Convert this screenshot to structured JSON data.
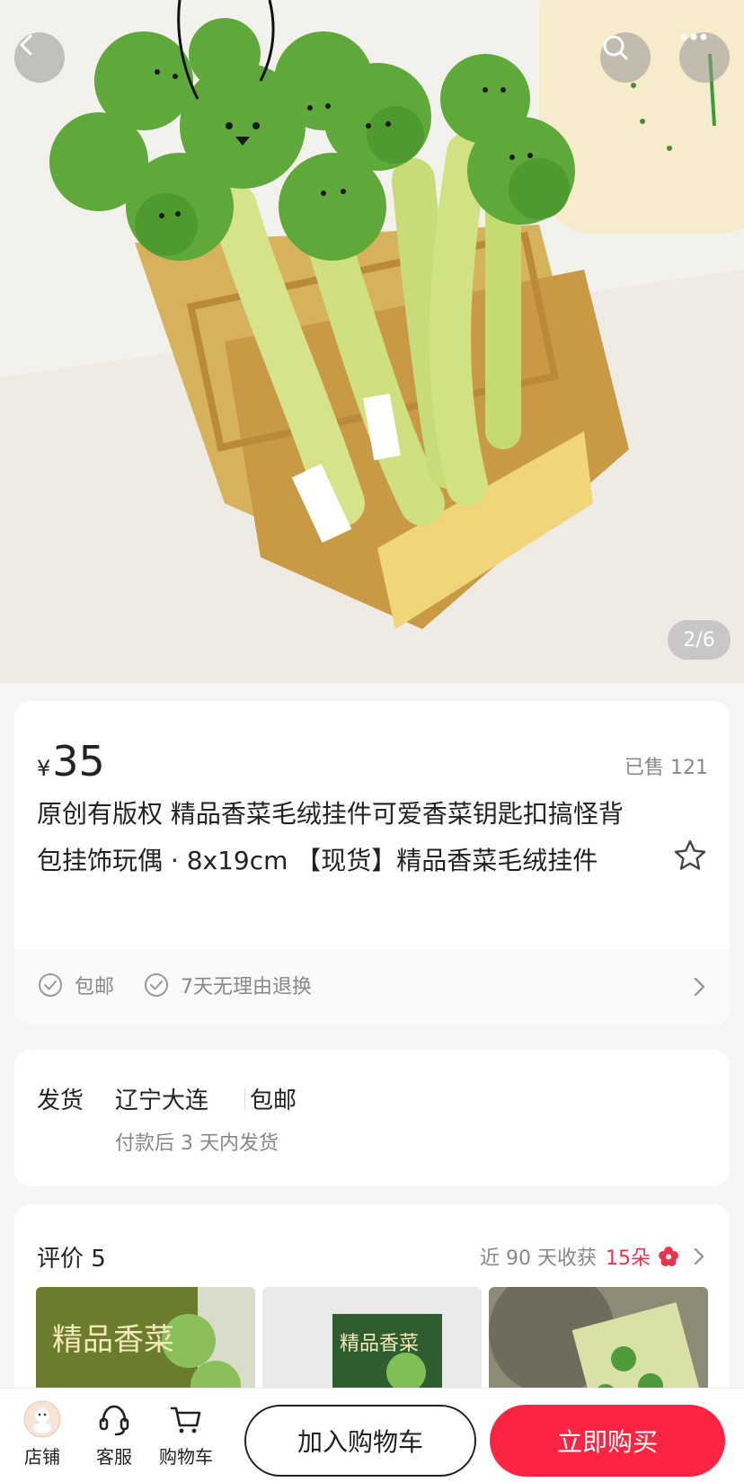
{
  "gallery": {
    "current": "2",
    "total": "6",
    "counter_text": "2/6",
    "image_subject": "plush cilantro keychains in a yellow storage bin"
  },
  "product": {
    "currency": "¥",
    "price": "35",
    "sold": "已售 121",
    "title": "原创有版权 精品香菜毛绒挂件可爱香菜钥匙扣搞怪背包挂饰玩偶 · 8x19cm 【现货】精品香菜毛绒挂件",
    "services": [
      "包邮",
      "7天无理由退换"
    ]
  },
  "shipping": {
    "label": "发货",
    "origin": "辽宁大连",
    "fee": "包邮",
    "note": "付款后 3 天内发货"
  },
  "reviews": {
    "title": "评价 5",
    "harvest_prefix": "近 90 天收获",
    "harvest_count": "15朵",
    "thumb_text": "精品香菜"
  },
  "bottom_bar": {
    "shop": "店铺",
    "service": "客服",
    "cart": "购物车",
    "add_to_cart": "加入购物车",
    "buy_now": "立即购买"
  },
  "colors": {
    "accent": "#ff2442",
    "highlight": "#e8354b",
    "plush_green": "#5fa83a"
  }
}
